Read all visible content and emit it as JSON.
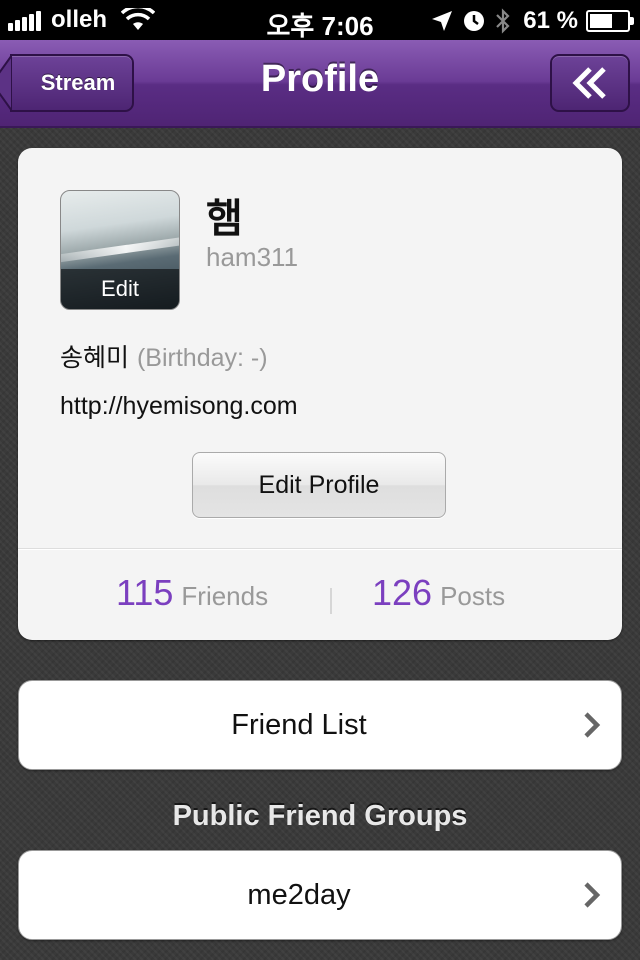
{
  "status_bar": {
    "carrier": "olleh",
    "time": "오후 7:06",
    "battery_percent": "61 %",
    "battery_level": 0.61,
    "icons": [
      "signal-icon",
      "wifi-icon",
      "location-icon",
      "alarm-icon",
      "bluetooth-icon",
      "battery-icon"
    ]
  },
  "nav": {
    "title": "Profile",
    "back_label": "Stream",
    "menu_icon": "double-chevron-left-icon"
  },
  "profile": {
    "avatar_edit_label": "Edit",
    "display_name": "햄",
    "username": "ham311",
    "real_name": "송혜미",
    "birthday": "(Birthday: -)",
    "website": "http://hyemisong.com",
    "edit_button_label": "Edit Profile",
    "friends_count": "115",
    "friends_label": "Friends",
    "posts_count": "126",
    "posts_label": "Posts"
  },
  "friend_list": {
    "label": "Friend List"
  },
  "public_groups": {
    "header": "Public Friend Groups",
    "items": [
      {
        "label": "me2day"
      }
    ]
  },
  "colors": {
    "accent_purple": "#7b3fbf",
    "nav_purple": "#6a3b95",
    "background": "#3a3a3a"
  }
}
